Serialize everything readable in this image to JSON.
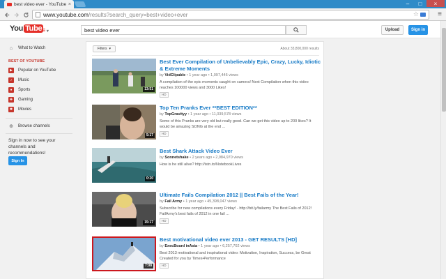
{
  "browser": {
    "tab_title": "best video ever - YouTube",
    "tab_close": "×",
    "url_host": "www.youtube.com",
    "url_path": "/results?search_query=best+video+ever",
    "icons": [
      "back-arrow-icon",
      "forward-arrow-icon",
      "reload-icon",
      "star-icon",
      "menu-icon"
    ],
    "win_minimize": "–",
    "win_maximize": "□",
    "win_close": "×"
  },
  "header": {
    "logo_you": "You",
    "logo_tube": "Tube",
    "guide_icon": "≡",
    "search_value": "best video ever",
    "upload_label": "Upload",
    "signin_label": "Sign in",
    "accent_color": "#e52d27",
    "primary_blue": "#2793e6"
  },
  "sidebar": {
    "what_to_watch": "What to Watch",
    "heading": "BEST OF YOUTUBE",
    "items": [
      {
        "label": "Popular on YouTube",
        "icon": "popular-icon"
      },
      {
        "label": "Music",
        "icon": "music-icon"
      },
      {
        "label": "Sports",
        "icon": "sports-icon"
      },
      {
        "label": "Gaming",
        "icon": "gaming-icon"
      },
      {
        "label": "Movies",
        "icon": "movies-icon"
      }
    ],
    "browse_channels": "Browse channels",
    "signin_prompt": "Sign in now to see your channels and recommendations!",
    "signin_button": "Sign In"
  },
  "results": {
    "filters_label": "Filters",
    "count": "About 33,800,000 results",
    "videos": [
      {
        "title": "Best Ever Compilation of Unbelievably Epic, Crazy, Lucky, Idiotic & Extreme Moments",
        "channel": "VidClipable",
        "meta": "• 1 year ago • 1,097,446 views",
        "description": "A compilation of the epic moments caught on camera! Next Compilation when this video reaches 100000 views and 3000 Likes!",
        "duration": "13:51",
        "hd": "HD"
      },
      {
        "title": "Top Ten Pranks Ever **BEST EDITION**",
        "channel": "TopGravityy",
        "meta": "• 1 year ago • 11,039,578 views",
        "description": "Some of this Pranks are very old but really good. Can we get this video up to 200 likes? It would be amazing SONG at the end ...",
        "duration": "5:17",
        "hd": "HD"
      },
      {
        "title": "Best Shark Attack Video Ever",
        "channel": "Sonnetshake",
        "meta": "• 2 years ago • 2,984,970 views",
        "description": "How is he still alive? http://istn.to/NotebookLives",
        "duration": "0:20",
        "hd": ""
      },
      {
        "title": "Ultimate Fails Compilation 2012 || Best Fails of the Year!",
        "channel": "Fail Army",
        "meta": "• 1 year ago • 45,398,047 views",
        "description": "Subscribe for new compilations every Friday! - http://bit.ly/failarmy The Best Fails of 2012! FailArmy's best fails of 2012 in one fail ...",
        "duration": "15:17",
        "hd": "HD"
      },
      {
        "title": "Best motivational video ever 2013 - GET RESULTS [HD]",
        "channel": "ExecBoard inAsia",
        "meta": "• 1 year ago • 6,257,702 views",
        "description": "Best 2013 motivational and inspirational video: Motivation, Inspiration, Success, be Great Created for you by Times•Performance",
        "duration": "7:08",
        "hd": "HD"
      }
    ]
  }
}
